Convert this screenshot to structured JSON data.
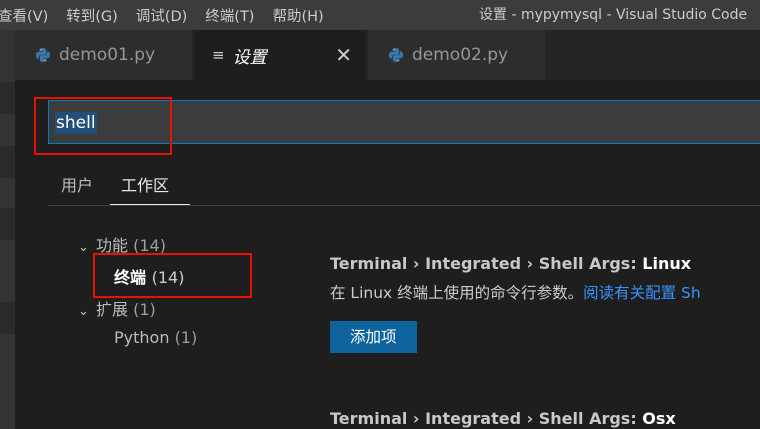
{
  "menu": [
    "查看(V)",
    "转到(G)",
    "调试(D)",
    "终端(T)",
    "帮助(H)"
  ],
  "window_title": "设置 - mypymysql - Visual Studio Code",
  "tabs": [
    {
      "label": "demo01.py",
      "icon": "python-icon"
    },
    {
      "label": "设置",
      "icon": "settings-icon"
    },
    {
      "label": "demo02.py",
      "icon": "python-icon"
    }
  ],
  "search": {
    "value": "shell"
  },
  "scopes": [
    "用户",
    "工作区"
  ],
  "toc": [
    {
      "label": "功能",
      "count": "(14)"
    },
    {
      "label": "终端",
      "count": "(14)"
    },
    {
      "label": "扩展",
      "count": "(1)"
    },
    {
      "label": "Python",
      "count": "(1)"
    }
  ],
  "settings": [
    {
      "path": "Terminal › Integrated › Shell Args: ",
      "leaf": "Linux",
      "desc": "在 Linux 终端上使用的命令行参数。",
      "link": "阅读有关配置 Sh",
      "button": "添加项"
    },
    {
      "path": "Terminal › Integrated › Shell Args: ",
      "leaf": "Osx"
    }
  ],
  "colors": {
    "accent": "#007acc",
    "button": "#0e639c",
    "highlight_box": "#e51400",
    "link": "#3794ff"
  }
}
